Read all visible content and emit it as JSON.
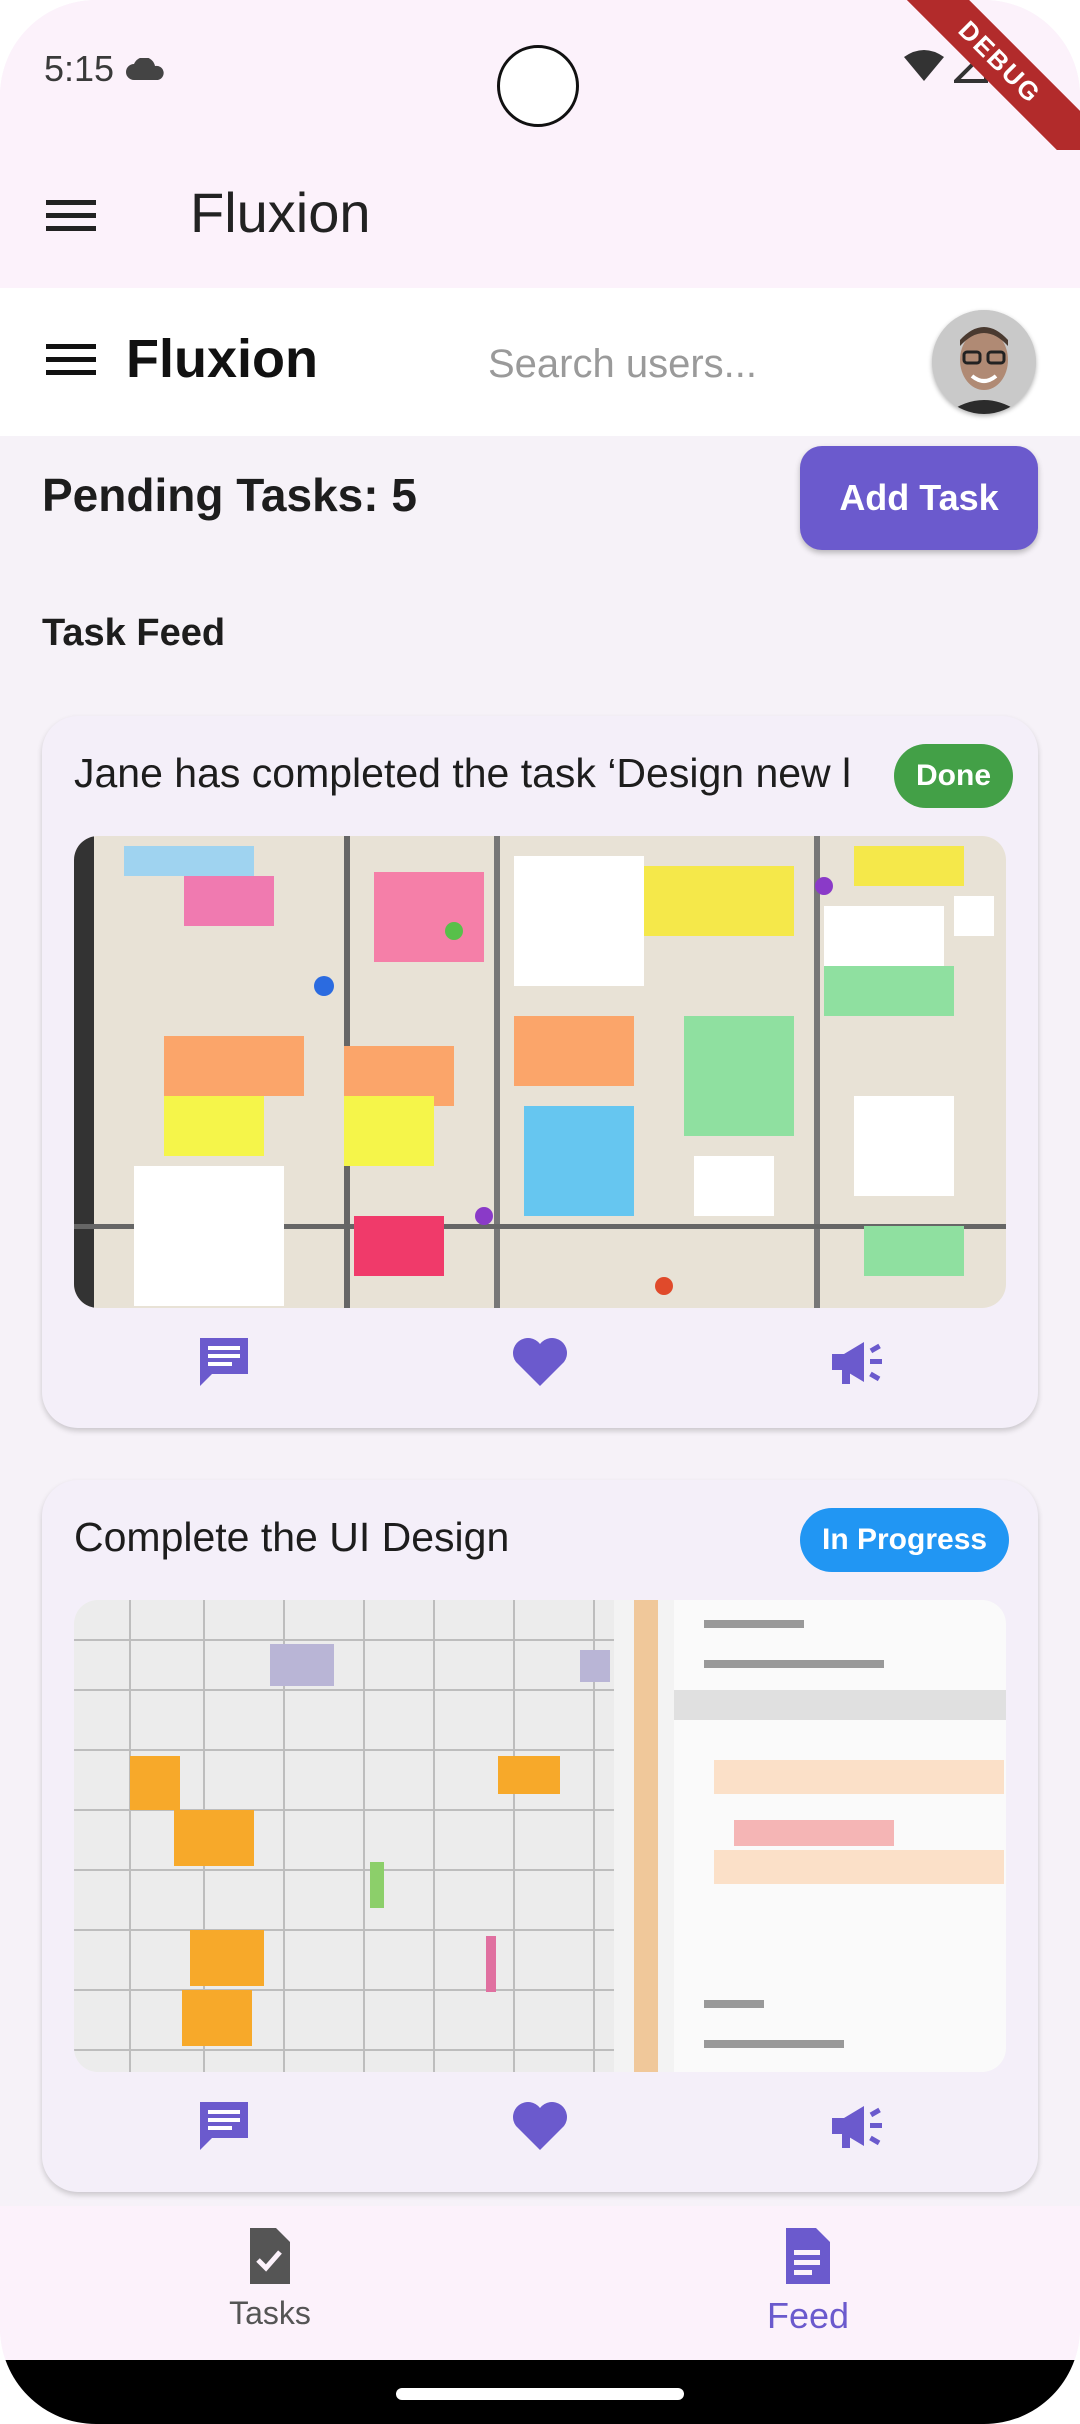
{
  "status_bar": {
    "time": "5:15",
    "debug_label": "DEBUG"
  },
  "app_bar": {
    "title": "Fluxion"
  },
  "header": {
    "title": "Fluxion",
    "search_placeholder": "Search users..."
  },
  "tasks": {
    "pending_label": "Pending Tasks: 5",
    "add_task_label": "Add Task"
  },
  "feed": {
    "heading": "Task Feed",
    "cards": [
      {
        "text": "Jane has completed the task ‘Design new l",
        "status": "Done",
        "status_color": "#43a047",
        "image": "sticky-notes-board"
      },
      {
        "text": "Complete the UI Design",
        "status": "In Progress",
        "status_color": "#2196f3",
        "image": "calendar-ui-mockup"
      }
    ]
  },
  "bottom_nav": {
    "items": [
      {
        "label": "Tasks",
        "icon": "task-document-icon",
        "active": false
      },
      {
        "label": "Feed",
        "icon": "feed-document-icon",
        "active": true
      }
    ]
  },
  "colors": {
    "accent": "#6b5acd",
    "done": "#43a047",
    "in_progress": "#2196f3",
    "surface": "#fcf2fb"
  }
}
